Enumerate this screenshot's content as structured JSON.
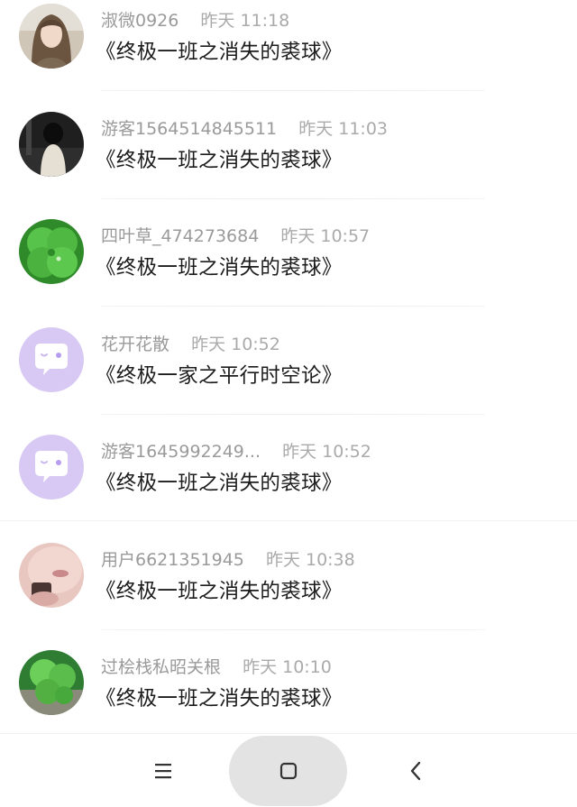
{
  "comments": [
    {
      "name": "淑微0926",
      "time": "昨天 11:18",
      "title": "《终极一班之消失的裘球》",
      "avatar": "girl-photo-avatar"
    },
    {
      "name": "游客1564514845511",
      "time": "昨天 11:03",
      "title": "《终极一班之消失的裘球》",
      "avatar": "dark-figure-avatar"
    },
    {
      "name": "四叶草_474273684",
      "time": "昨天 10:57",
      "title": "《终极一班之消失的裘球》",
      "avatar": "clover-avatar"
    },
    {
      "name": "花开花散",
      "time": "昨天 10:52",
      "title": "《终极一家之平行时空论》",
      "avatar": "chat-bubble-avatar"
    },
    {
      "name": "游客1645992249...",
      "time": "昨天 10:52",
      "title": "《终极一班之消失的裘球》",
      "avatar": "chat-bubble-avatar"
    },
    {
      "name": "用户6621351945",
      "time": "昨天 10:38",
      "title": "《终极一班之消失的裘球》",
      "avatar": "pink-photo-avatar"
    },
    {
      "name": "过桧栈私昭关根",
      "time": "昨天 10:10",
      "title": "《终极一班之消失的裘球》",
      "avatar": "clover-avatar"
    }
  ],
  "navbar": {
    "menu_icon": "menu-icon",
    "home_icon": "home-square-icon",
    "back_icon": "back-chevron-icon"
  }
}
